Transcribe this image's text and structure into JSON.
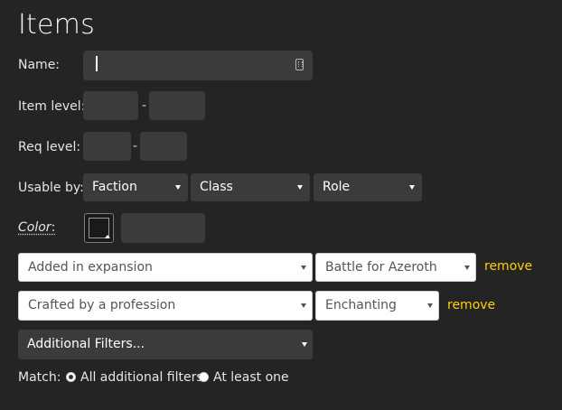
{
  "page": {
    "title": "Items"
  },
  "form": {
    "name_label": "Name:",
    "name_value": "",
    "item_level_label": "Item level:",
    "item_level_min": "",
    "item_level_max": "",
    "item_level_separator": "-",
    "req_level_label": "Req level:",
    "req_level_min": "",
    "req_level_max": "",
    "req_level_separator": "-",
    "usable_by_label": "Usable by:",
    "faction_select": "Faction",
    "class_select": "Class",
    "role_select": "Role",
    "color_label": "Color",
    "color_colon": ":",
    "color_value": ""
  },
  "filters": [
    {
      "criterion": "Added in expansion",
      "value": "Battle for Azeroth",
      "remove_label": "remove"
    },
    {
      "criterion": "Crafted by a profession",
      "value": "Enchanting",
      "remove_label": "remove"
    }
  ],
  "additional_filters": {
    "label": "Additional Filters..."
  },
  "match": {
    "label": "Match:",
    "options": [
      {
        "label": "All additional filters",
        "checked": true
      },
      {
        "label": "At least one",
        "checked": false
      }
    ]
  },
  "colors": {
    "background": "#242424",
    "field": "#3b3b3b",
    "link": "#ffd100"
  }
}
